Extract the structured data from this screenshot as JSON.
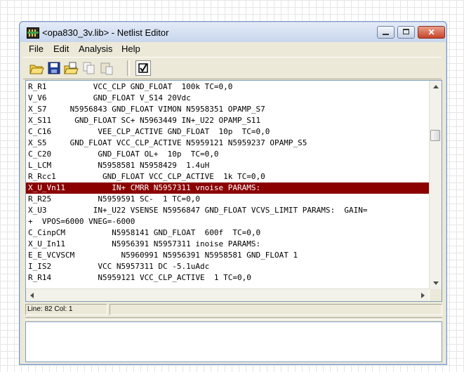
{
  "window": {
    "title": "<opa830_3v.lib> - Netlist Editor"
  },
  "menu": [
    "File",
    "Edit",
    "Analysis",
    "Help"
  ],
  "toolbar": {
    "buttons": [
      "open-folder-icon",
      "save-icon",
      "open-file-icon",
      "copy-icon",
      "paste-icon",
      "check-icon"
    ]
  },
  "editor": {
    "selected_index": 9,
    "lines": [
      "R_R1          VCC_CLP GND_FLOAT  100k TC=0,0",
      "V_V6          GND_FLOAT V_S14 20Vdc",
      "X_S7     N5956843 GND_FLOAT VIMON N5958351 OPAMP_S7",
      "X_S11     GND_FLOAT SC+ N5963449 IN+_U22 OPAMP_S11",
      "C_C16          VEE_CLP_ACTIVE GND_FLOAT  10p  TC=0,0",
      "X_S5     GND_FLOAT VCC_CLP_ACTIVE N5959121 N5959237 OPAMP_S5",
      "C_C20          GND_FLOAT OL+  10p  TC=0,0",
      "L_LCM          N5958581 N5958429  1.4uH",
      "R_Rcc1          GND_FLOAT VCC_CLP_ACTIVE  1k TC=0,0",
      "X_U_Vn11          IN+ CMRR N5957311 vnoise PARAMS:",
      "R_R25          N5959591 SC-  1 TC=0,0",
      "X_U3          IN+_U22 VSENSE N5956847 GND_FLOAT VCVS_LIMIT PARAMS:  GAIN=",
      "+  VPOS=6000 VNEG=-6000",
      "C_CinpCM          N5958141 GND_FLOAT  600f  TC=0,0",
      "X_U_In11          N5956391 N5957311 inoise PARAMS:",
      "E_E_VCVSCM          N5960991 N5956391 N5958581 GND_FLOAT 1",
      "I_IS2          VCC N5957311 DC -5.1uAdc",
      "R_R14          N5959121 VCC_CLP_ACTIVE  1 TC=0,0"
    ]
  },
  "status": {
    "position": "Line: 82 Col: 1",
    "secondary": ""
  },
  "output": {
    "text": ""
  }
}
